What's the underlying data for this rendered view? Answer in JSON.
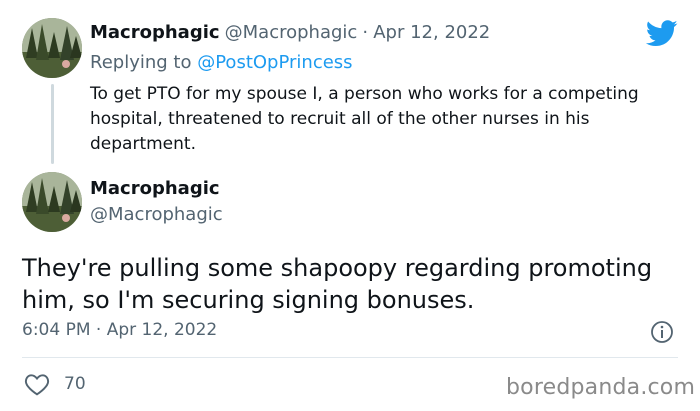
{
  "reply_tweet": {
    "author_name": "Macrophagic",
    "author_handle": "@Macrophagic",
    "separator": "·",
    "date": "Apr 12, 2022",
    "replying_to_prefix": "Replying to",
    "replying_to_handle": "@PostOpPrincess",
    "text": "To get PTO for my spouse I, a person who works for a competing hospital, threatened to recruit all of the other nurses in his department."
  },
  "main_tweet": {
    "author_name": "Macrophagic",
    "author_handle": "@Macrophagic",
    "text": "They're pulling some shapoopy regarding promoting him, so I'm securing signing bonuses.",
    "time": "6:04 PM",
    "separator": "·",
    "date": "Apr 12, 2022",
    "like_count": "70"
  },
  "watermark": "boredpanda.com",
  "icons": {
    "brand": "twitter-bird-icon",
    "info": "info-icon",
    "like": "heart-icon"
  },
  "colors": {
    "twitter_blue": "#1d9bf0",
    "text_primary": "#0f1419",
    "text_secondary": "#536471",
    "divider": "#e1e8ed"
  }
}
